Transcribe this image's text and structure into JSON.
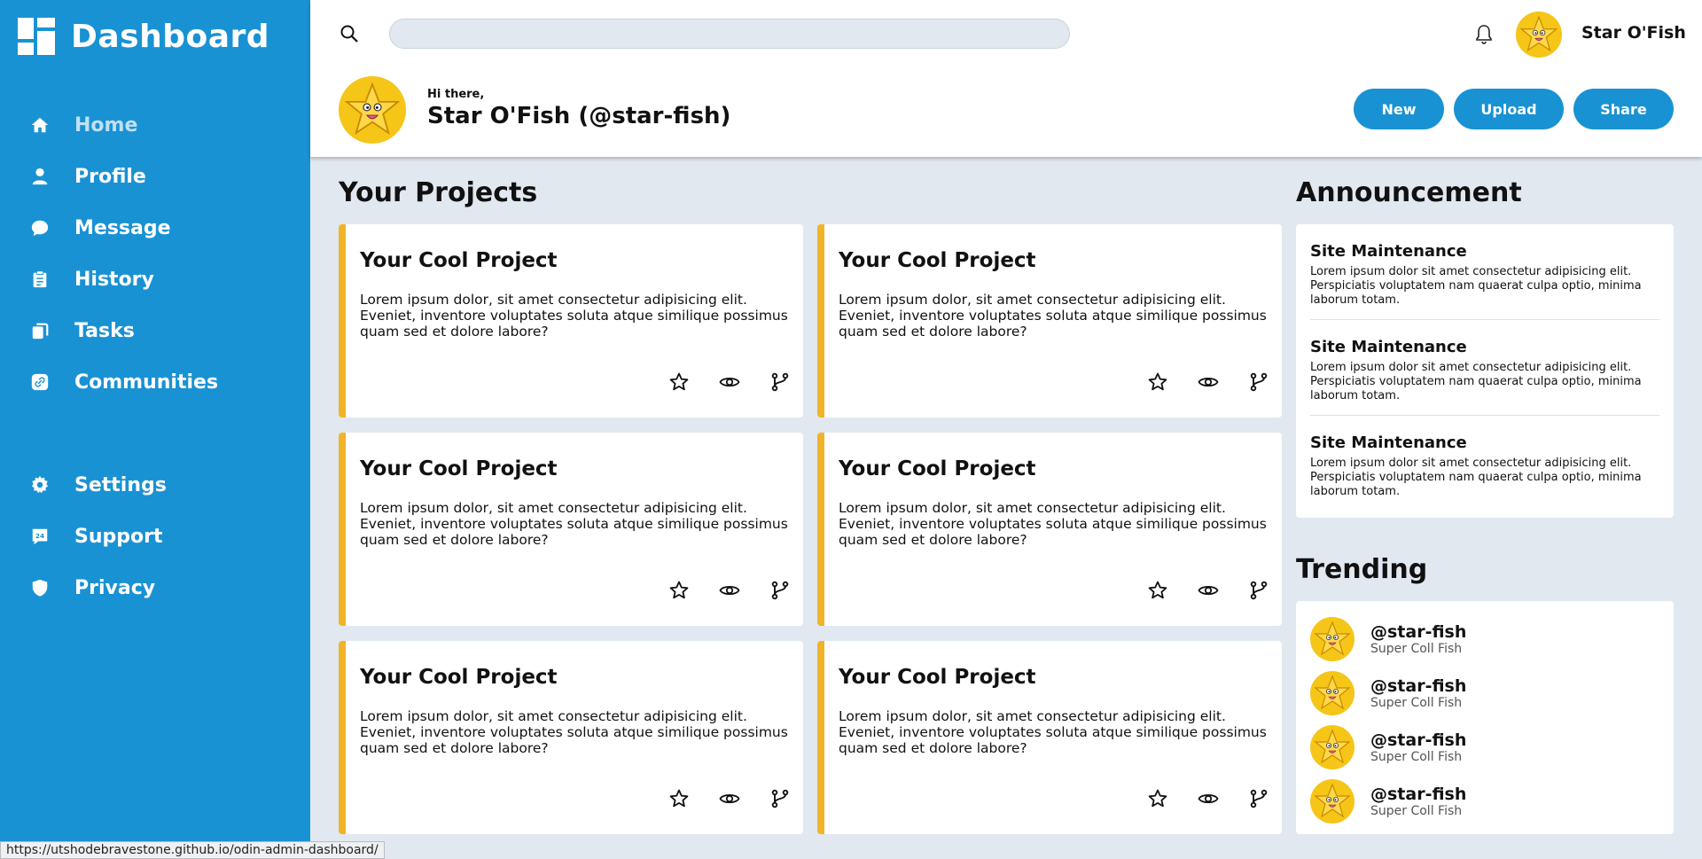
{
  "brand": {
    "title": "Dashboard",
    "icon": "dashboard-grid-icon"
  },
  "nav": {
    "items": [
      {
        "label": "Home",
        "icon": "home-icon"
      },
      {
        "label": "Profile",
        "icon": "user-icon"
      },
      {
        "label": "Message",
        "icon": "chat-icon"
      },
      {
        "label": "History",
        "icon": "clipboard-icon"
      },
      {
        "label": "Tasks",
        "icon": "copy-icon"
      },
      {
        "label": "Communities",
        "icon": "link-icon"
      },
      {
        "label": "Settings",
        "icon": "gear-icon"
      },
      {
        "label": "Support",
        "icon": "support-24-icon"
      },
      {
        "label": "Privacy",
        "icon": "shield-icon"
      }
    ]
  },
  "header": {
    "search": {
      "value": "",
      "placeholder": ""
    },
    "user_name": "Star O'Fish",
    "greeting": "Hi there,",
    "greeting_name": "Star O'Fish (@star-fish)",
    "buttons": {
      "new": "New",
      "upload": "Upload",
      "share": "Share"
    }
  },
  "projects": {
    "title": "Your Projects",
    "cards": [
      {
        "title": "Your Cool Project",
        "body": "Lorem ipsum dolor, sit amet consectetur adipisicing elit. Eveniet, inventore voluptates soluta atque similique possimus quam sed et dolore labore?"
      },
      {
        "title": "Your Cool Project",
        "body": "Lorem ipsum dolor, sit amet consectetur adipisicing elit. Eveniet, inventore voluptates soluta atque similique possimus quam sed et dolore labore?"
      },
      {
        "title": "Your Cool Project",
        "body": "Lorem ipsum dolor, sit amet consectetur adipisicing elit. Eveniet, inventore voluptates soluta atque similique possimus quam sed et dolore labore?"
      },
      {
        "title": "Your Cool Project",
        "body": "Lorem ipsum dolor, sit amet consectetur adipisicing elit. Eveniet, inventore voluptates soluta atque similique possimus quam sed et dolore labore?"
      },
      {
        "title": "Your Cool Project",
        "body": "Lorem ipsum dolor, sit amet consectetur adipisicing elit. Eveniet, inventore voluptates soluta atque similique possimus quam sed et dolore labore?"
      },
      {
        "title": "Your Cool Project",
        "body": "Lorem ipsum dolor, sit amet consectetur adipisicing elit. Eveniet, inventore voluptates soluta atque similique possimus quam sed et dolore labore?"
      }
    ]
  },
  "announcement": {
    "title": "Announcement",
    "items": [
      {
        "title": "Site Maintenance",
        "body": "Lorem ipsum dolor sit amet consectetur adipisicing elit. Perspiciatis voluptatem nam quaerat culpa optio, minima laborum totam."
      },
      {
        "title": "Site Maintenance",
        "body": "Lorem ipsum dolor sit amet consectetur adipisicing elit. Perspiciatis voluptatem nam quaerat culpa optio, minima laborum totam."
      },
      {
        "title": "Site Maintenance",
        "body": "Lorem ipsum dolor sit amet consectetur adipisicing elit. Perspiciatis voluptatem nam quaerat culpa optio, minima laborum totam."
      }
    ]
  },
  "trending": {
    "title": "Trending",
    "items": [
      {
        "handle": "@star-fish",
        "sub": "Super Coll Fish"
      },
      {
        "handle": "@star-fish",
        "sub": "Super Coll Fish"
      },
      {
        "handle": "@star-fish",
        "sub": "Super Coll Fish"
      },
      {
        "handle": "@star-fish",
        "sub": "Super Coll Fish"
      }
    ]
  },
  "status_bar": {
    "url": "https://utshodebravestone.github.io/odin-admin-dashboard/"
  },
  "colors": {
    "primary": "#1992d4",
    "accent": "#f0b429",
    "background": "#e2e8f0"
  }
}
